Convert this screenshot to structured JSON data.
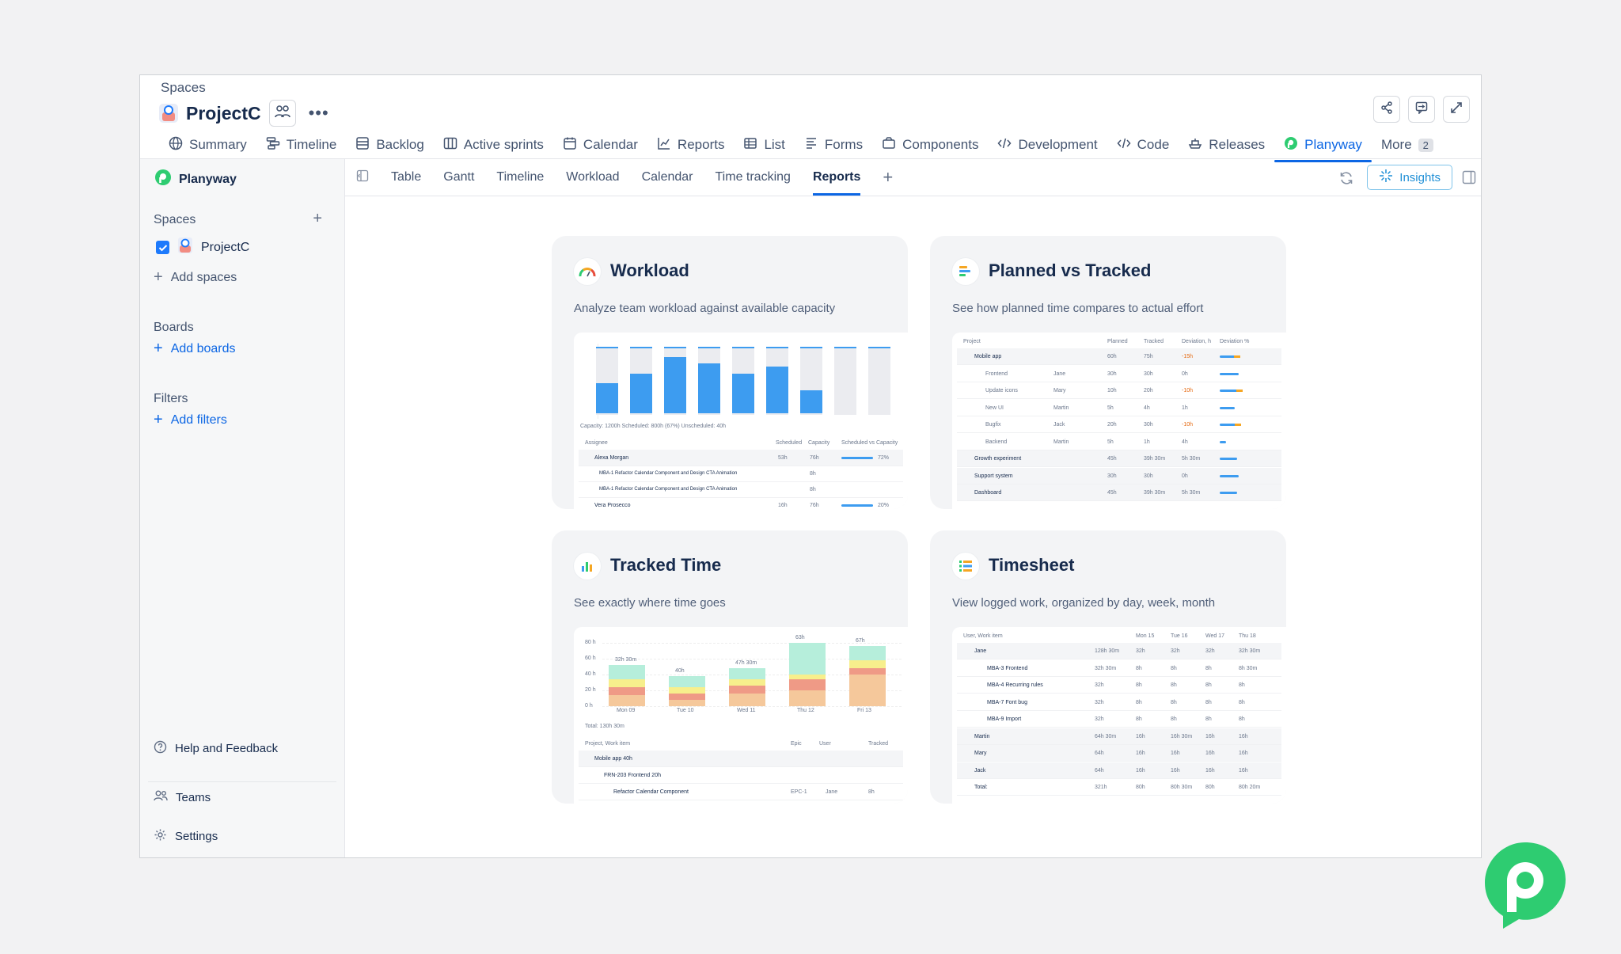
{
  "header": {
    "breadcrumb": "Spaces",
    "project_title": "ProjectC",
    "more_label": "More",
    "more_count": "2",
    "nav": [
      {
        "label": "Summary",
        "icon": "globe-icon"
      },
      {
        "label": "Timeline",
        "icon": "timeline-icon"
      },
      {
        "label": "Backlog",
        "icon": "backlog-icon"
      },
      {
        "label": "Active sprints",
        "icon": "board-icon"
      },
      {
        "label": "Calendar",
        "icon": "calendar-icon"
      },
      {
        "label": "Reports",
        "icon": "chart-line-icon"
      },
      {
        "label": "List",
        "icon": "list-icon"
      },
      {
        "label": "Forms",
        "icon": "forms-icon"
      },
      {
        "label": "Components",
        "icon": "components-icon"
      },
      {
        "label": "Development",
        "icon": "code-icon"
      },
      {
        "label": "Code",
        "icon": "code-icon"
      },
      {
        "label": "Releases",
        "icon": "ship-icon"
      },
      {
        "label": "Planyway",
        "icon": "planyway-icon",
        "active": true
      }
    ]
  },
  "sidebar": {
    "brand": "Planyway",
    "spaces_heading": "Spaces",
    "space_item": "ProjectC",
    "add_spaces": "Add spaces",
    "boards_heading": "Boards",
    "add_boards": "Add boards",
    "filters_heading": "Filters",
    "add_filters": "Add filters",
    "help": "Help and Feedback",
    "teams": "Teams",
    "settings": "Settings"
  },
  "toolbar": {
    "tabs": [
      "Table",
      "Gantt",
      "Timeline",
      "Workload",
      "Calendar",
      "Time tracking",
      "Reports"
    ],
    "active_tab": "Reports",
    "insights_label": "Insights"
  },
  "cards": {
    "workload": {
      "title": "Workload",
      "description": "Analyze team workload against available capacity",
      "preview": {
        "bar_fill": [
          0.45,
          0.6,
          0.85,
          0.75,
          0.6,
          0.7,
          0.35,
          0,
          0
        ],
        "legend": "Capacity: 1200h   Scheduled: 800h (67%)   Unscheduled: 40h",
        "cols": [
          "Assignee",
          "Scheduled",
          "Capacity",
          "Scheduled vs Capacity"
        ],
        "rows": [
          {
            "name": "Alexa Morgan",
            "a": "53h",
            "b": "76h",
            "pct": "72%"
          },
          {
            "name": "MBA-1 Refactor Calendar Component and Design CTA Animation",
            "a": "",
            "b": "8h",
            "pct": ""
          },
          {
            "name": "MBA-1 Refactor Calendar Component and Design CTA Animation",
            "a": "",
            "b": "8h",
            "pct": ""
          },
          {
            "name": "Vera Prosecco",
            "a": "16h",
            "b": "76h",
            "pct": "20%"
          }
        ]
      }
    },
    "planned": {
      "title": "Planned vs Tracked",
      "description": "See how planned time compares to actual effort",
      "preview": {
        "cols": [
          "Project",
          "Planned",
          "Tracked",
          "Deviation, h",
          "Deviation %"
        ],
        "rows": [
          {
            "name": "Mobile app",
            "user": "",
            "p": "60h",
            "t": "75h",
            "d": "-15h",
            "neg": true,
            "bar": 0.8
          },
          {
            "name": "Frontend",
            "user": "Jane",
            "p": "30h",
            "t": "30h",
            "d": "0h",
            "neg": false,
            "bar": 0.75
          },
          {
            "name": "Update icons",
            "user": "Mary",
            "p": "10h",
            "t": "20h",
            "d": "-10h",
            "neg": true,
            "bar": 0.9
          },
          {
            "name": "New UI",
            "user": "Martin",
            "p": "5h",
            "t": "4h",
            "d": "1h",
            "neg": false,
            "bar": 0.6
          },
          {
            "name": "Bugfix",
            "user": "Jack",
            "p": "20h",
            "t": "30h",
            "d": "-10h",
            "neg": true,
            "bar": 0.85
          },
          {
            "name": "Backend",
            "user": "Martin",
            "p": "5h",
            "t": "1h",
            "d": "4h",
            "neg": false,
            "bar": 0.25
          },
          {
            "name": "Growth experiment",
            "user": "",
            "p": "45h",
            "t": "39h 30m",
            "d": "5h 30m",
            "neg": false,
            "bar": 0.7
          },
          {
            "name": "Support system",
            "user": "",
            "p": "30h",
            "t": "30h",
            "d": "0h",
            "neg": false,
            "bar": 0.75
          },
          {
            "name": "Dashboard",
            "user": "",
            "p": "45h",
            "t": "39h 30m",
            "d": "5h 30m",
            "neg": false,
            "bar": 0.7
          }
        ]
      }
    },
    "tracked": {
      "title": "Tracked Time",
      "description": "See exactly where time goes",
      "preview": {
        "yticks": [
          "80 h",
          "60 h",
          "40 h",
          "20 h",
          "0 h"
        ],
        "days": [
          "Mon 09",
          "Tue 10",
          "Wed 11",
          "Thu 12",
          "Fri 13"
        ],
        "totals": [
          "32h 30m",
          "40h",
          "47h 30m",
          "63h",
          "67h"
        ],
        "stacks": [
          [
            14,
            10,
            10,
            18
          ],
          [
            8,
            8,
            8,
            14
          ],
          [
            16,
            10,
            8,
            14
          ],
          [
            20,
            14,
            6,
            40
          ],
          [
            40,
            8,
            10,
            18
          ]
        ],
        "colors": [
          "#f5c89b",
          "#ef9a86",
          "#f7ef8c",
          "#b6eedb"
        ],
        "total": "Total: 130h 30m",
        "cols": [
          "Project, Work item",
          "Epic",
          "User",
          "Tracked"
        ],
        "rows": [
          {
            "name": "Mobile app 40h"
          },
          {
            "name": "FRN-203 Frontend 20h"
          },
          {
            "name": "Refactor Calendar Component",
            "epic": "EPC-1",
            "user": "Jane",
            "tracked": "8h"
          }
        ]
      }
    },
    "timesheet": {
      "title": "Timesheet",
      "description": "View logged work, organized by day, week, month",
      "preview": {
        "cols": [
          "User, Work item",
          "",
          "Mon 15",
          "Tue 16",
          "Wed 17",
          "Thu 18"
        ],
        "rows": [
          {
            "name": "Jane",
            "total": "128h 30m",
            "v": [
              "32h",
              "32h",
              "32h",
              "32h 30m"
            ],
            "group": true
          },
          {
            "name": "MBA-3 Frontend",
            "total": "32h 30m",
            "v": [
              "8h",
              "8h",
              "8h",
              "8h 30m"
            ]
          },
          {
            "name": "MBA-4 Recurring rules",
            "total": "32h",
            "v": [
              "8h",
              "8h",
              "8h",
              "8h"
            ]
          },
          {
            "name": "MBA-7 Font bug",
            "total": "32h",
            "v": [
              "8h",
              "8h",
              "8h",
              "8h"
            ]
          },
          {
            "name": "MBA-9 Import",
            "total": "32h",
            "v": [
              "8h",
              "8h",
              "8h",
              "8h"
            ]
          },
          {
            "name": "Martin",
            "total": "64h 30m",
            "v": [
              "16h",
              "16h 30m",
              "16h",
              "16h"
            ],
            "group": true
          },
          {
            "name": "Mary",
            "total": "64h",
            "v": [
              "16h",
              "16h",
              "16h",
              "16h"
            ],
            "group": true
          },
          {
            "name": "Jack",
            "total": "64h",
            "v": [
              "16h",
              "16h",
              "16h",
              "16h"
            ],
            "group": true
          },
          {
            "name": "Total:",
            "total": "321h",
            "v": [
              "80h",
              "80h 30m",
              "80h",
              "80h 20m"
            ],
            "group": false
          }
        ]
      }
    }
  },
  "colors": {
    "accent": "#0c66e4",
    "planyway_green": "#2ecc71",
    "bar_blue": "#3d9cf0"
  }
}
